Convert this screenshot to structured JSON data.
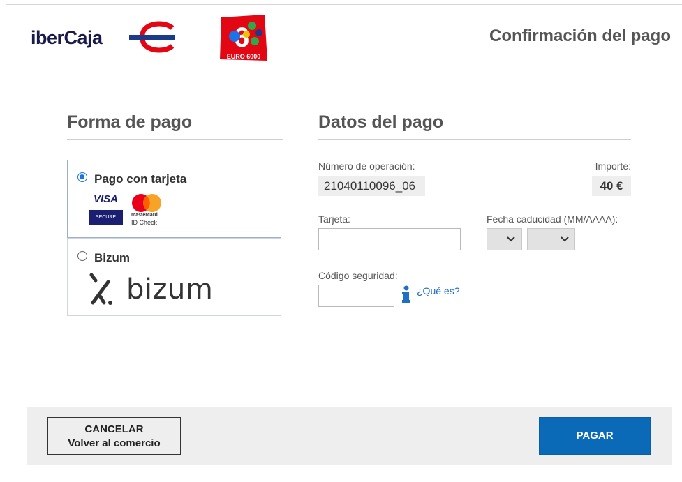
{
  "header": {
    "brand_name": "iberCaja",
    "secondary_logo_text": "EURO 6000",
    "page_title": "Confirmación del pago"
  },
  "payment_method": {
    "title": "Forma de pago",
    "options": [
      {
        "label": "Pago con tarjeta",
        "selected": true
      },
      {
        "label": "Bizum",
        "selected": false
      }
    ],
    "card_logos": {
      "visa": "VISA",
      "visa_sub": "SECURE",
      "mastercard_sub": "mastercard",
      "mastercard_id": "ID Check"
    },
    "bizum_logo_text": "bizum"
  },
  "payment_data": {
    "title": "Datos del pago",
    "operation_label": "Número de operación:",
    "operation_value": "21040110096_06",
    "amount_label": "Importe:",
    "amount_value": "40 €",
    "card_label": "Tarjeta:",
    "card_value": "",
    "expiry_label": "Fecha caducidad (MM/AAAA):",
    "expiry_month": "",
    "expiry_year": "",
    "cvv_label": "Código seguridad:",
    "cvv_value": "",
    "help_link": "¿Qué es?"
  },
  "actions": {
    "cancel_line1": "CANCELAR",
    "cancel_line2": "Volver al comercio",
    "pay_label": "PAGAR"
  },
  "colors": {
    "primary": "#0b6ab8",
    "radio_selected": "#1a73e8",
    "link": "#1f6fc5",
    "brand_red": "#e30613"
  }
}
